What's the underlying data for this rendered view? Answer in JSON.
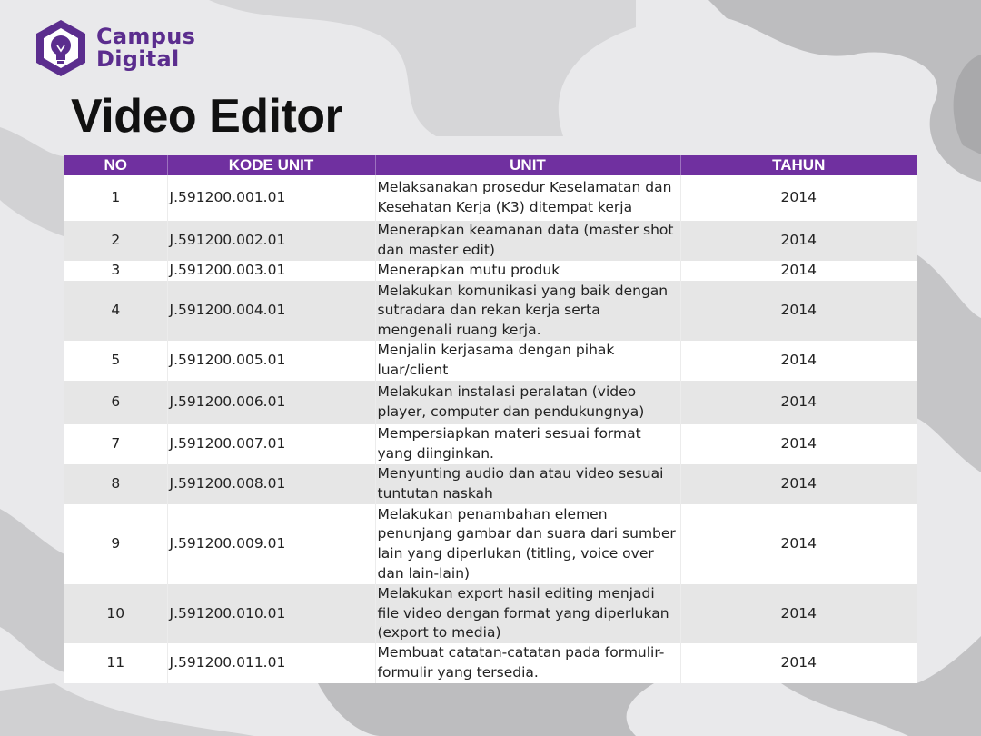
{
  "brand": {
    "line1": "Campus",
    "line2": "Digital",
    "color": "#5b2d8e"
  },
  "page": {
    "title": "Video Editor"
  },
  "table": {
    "header_color": "#7030a0",
    "columns": [
      "NO",
      "KODE UNIT",
      "UNIT",
      "TAHUN"
    ],
    "rows": [
      {
        "no": "1",
        "kode": "J.591200.001.01",
        "unit": "Melaksanakan prosedur Keselamatan dan Kesehatan Kerja (K3) ditempat kerja",
        "tahun": "2014"
      },
      {
        "no": "2",
        "kode": "J.591200.002.01",
        "unit": "Menerapkan keamanan data (master shot dan master edit)",
        "tahun": "2014"
      },
      {
        "no": "3",
        "kode": "J.591200.003.01",
        "unit": "Menerapkan mutu produk",
        "tahun": "2014"
      },
      {
        "no": "4",
        "kode": "J.591200.004.01",
        "unit": "Melakukan komunikasi yang baik dengan sutradara dan rekan kerja serta mengenali ruang kerja.",
        "tahun": "2014"
      },
      {
        "no": "5",
        "kode": "J.591200.005.01",
        "unit": "Menjalin kerjasama dengan pihak luar/client",
        "tahun": "2014"
      },
      {
        "no": "6",
        "kode": "J.591200.006.01",
        "unit": "Melakukan instalasi peralatan (video player, computer dan pendukungnya)",
        "tahun": "2014"
      },
      {
        "no": "7",
        "kode": "J.591200.007.01",
        "unit": "Mempersiapkan materi sesuai format yang diinginkan.",
        "tahun": "2014"
      },
      {
        "no": "8",
        "kode": "J.591200.008.01",
        "unit": "Menyunting audio dan atau video sesuai tuntutan naskah",
        "tahun": "2014"
      },
      {
        "no": "9",
        "kode": "J.591200.009.01",
        "unit": "Melakukan penambahan elemen penunjang gambar dan suara dari sumber lain yang diperlukan (titling, voice over dan lain-lain)",
        "tahun": "2014"
      },
      {
        "no": "10",
        "kode": "J.591200.010.01",
        "unit": "Melakukan export hasil editing menjadi file video dengan format yang diperlukan (export to media)",
        "tahun": "2014"
      },
      {
        "no": "11",
        "kode": "J.591200.011.01",
        "unit": "Membuat catatan-catatan pada formulir-formulir yang tersedia.",
        "tahun": "2014"
      }
    ]
  }
}
